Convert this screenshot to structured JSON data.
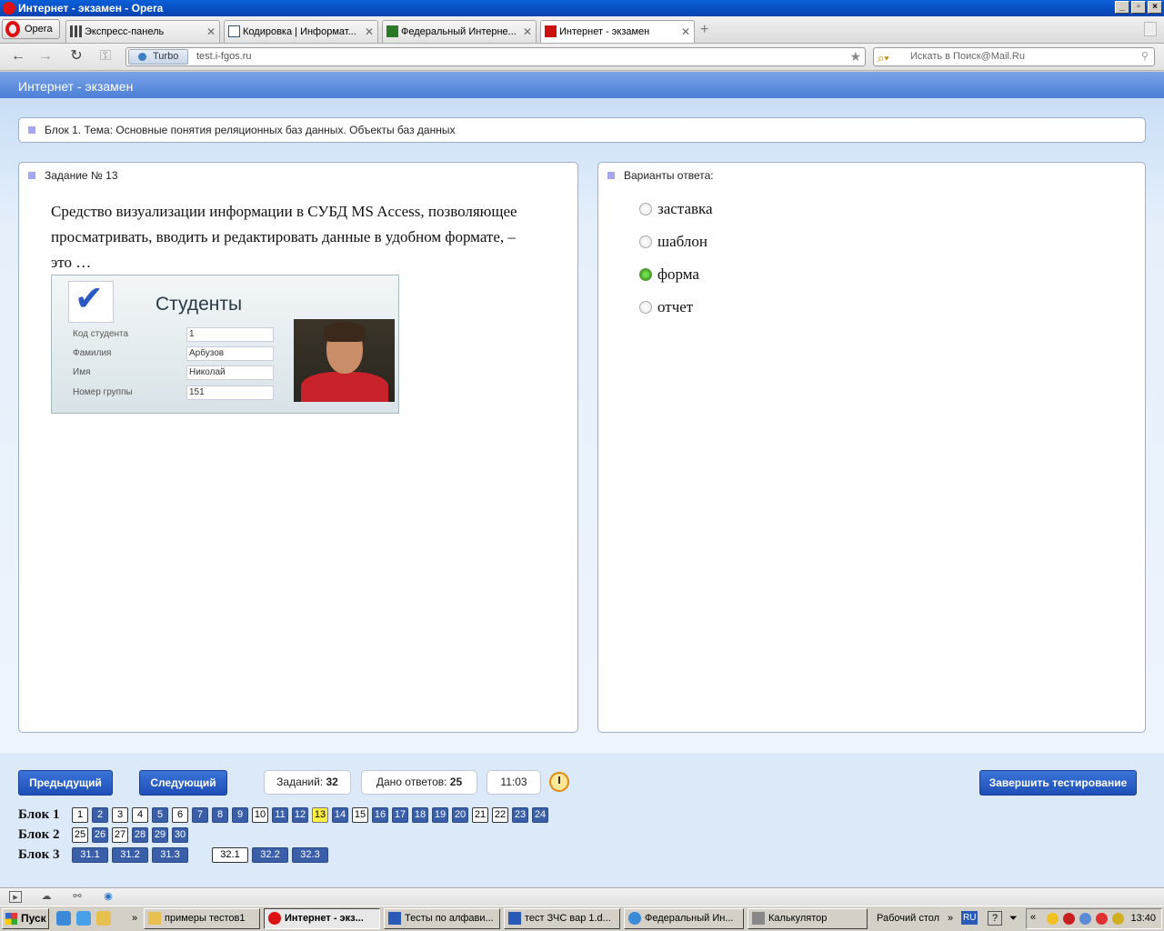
{
  "window": {
    "title": "Интернет - экзамен - Opera"
  },
  "browser": {
    "menu_label": "Opera",
    "tabs": [
      {
        "label": "Экспресс-панель"
      },
      {
        "label": "Кодировка | Информат..."
      },
      {
        "label": "Федеральный Интерне..."
      },
      {
        "label": "Интернет - экзамен"
      }
    ],
    "turbo_label": "Turbo",
    "url": "test.i-fgos.ru",
    "search_placeholder": "Искать в Поиск@Mail.Ru"
  },
  "page": {
    "header": "Интернет - экзамен",
    "block_title": "Блок 1. Тема: Основные понятия реляционных баз данных. Объекты баз данных",
    "task_title": "Задание № 13",
    "question": "Средство визуализации информации в СУБД MS Access, позволяющее просматривать, вводить и редактировать данные в удобном формате, – это …",
    "form_image": {
      "title": "Студенты",
      "fields": [
        {
          "label": "Код студента",
          "value": "1"
        },
        {
          "label": "Фамилия",
          "value": "Арбузов"
        },
        {
          "label": "Имя",
          "value": "Николай"
        },
        {
          "label": "Номер группы",
          "value": "151"
        }
      ]
    },
    "answers_title": "Варианты ответа:",
    "answers": [
      {
        "label": "заставка",
        "selected": false
      },
      {
        "label": "шаблон",
        "selected": false
      },
      {
        "label": "форма",
        "selected": true
      },
      {
        "label": "отчет",
        "selected": false
      }
    ]
  },
  "controls": {
    "prev": "Предыдущий",
    "next": "Следующий",
    "tasks_label": "Заданий:",
    "tasks_count": "32",
    "answered_label": "Дано ответов:",
    "answered_count": "25",
    "timer": "11:03",
    "finish": "Завершить тестирование"
  },
  "blocks": [
    {
      "label": "Блок 1",
      "items": [
        {
          "n": "1",
          "s": "white"
        },
        {
          "n": "2",
          "s": "blue"
        },
        {
          "n": "3",
          "s": "white"
        },
        {
          "n": "4",
          "s": "white"
        },
        {
          "n": "5",
          "s": "blue"
        },
        {
          "n": "6",
          "s": "white"
        },
        {
          "n": "7",
          "s": "blue"
        },
        {
          "n": "8",
          "s": "blue"
        },
        {
          "n": "9",
          "s": "blue"
        },
        {
          "n": "10",
          "s": "white"
        },
        {
          "n": "11",
          "s": "blue"
        },
        {
          "n": "12",
          "s": "blue"
        },
        {
          "n": "13",
          "s": "yellow"
        },
        {
          "n": "14",
          "s": "blue"
        },
        {
          "n": "15",
          "s": "white"
        },
        {
          "n": "16",
          "s": "blue"
        },
        {
          "n": "17",
          "s": "blue"
        },
        {
          "n": "18",
          "s": "blue"
        },
        {
          "n": "19",
          "s": "blue"
        },
        {
          "n": "20",
          "s": "blue"
        },
        {
          "n": "21",
          "s": "white"
        },
        {
          "n": "22",
          "s": "white"
        },
        {
          "n": "23",
          "s": "blue"
        },
        {
          "n": "24",
          "s": "blue"
        }
      ]
    },
    {
      "label": "Блок 2",
      "items": [
        {
          "n": "25",
          "s": "white"
        },
        {
          "n": "26",
          "s": "blue"
        },
        {
          "n": "27",
          "s": "white"
        },
        {
          "n": "28",
          "s": "blue"
        },
        {
          "n": "29",
          "s": "blue"
        },
        {
          "n": "30",
          "s": "blue"
        }
      ]
    },
    {
      "label": "Блок 3",
      "items": [
        {
          "n": "31.1",
          "s": "blue"
        },
        {
          "n": "31.2",
          "s": "blue"
        },
        {
          "n": "31.3",
          "s": "blue"
        },
        {
          "n": "32.1",
          "s": "white"
        },
        {
          "n": "32.2",
          "s": "blue"
        },
        {
          "n": "32.3",
          "s": "blue"
        }
      ]
    }
  ],
  "taskbar": {
    "start": "Пуск",
    "tasks": [
      {
        "label": "примеры тестов1"
      },
      {
        "label": "Интернет - экз..."
      },
      {
        "label": "Тесты по алфави..."
      },
      {
        "label": "тест ЗЧС вар 1.d..."
      },
      {
        "label": "Федеральный Ин..."
      },
      {
        "label": "Калькулятор"
      }
    ],
    "desktop": "Рабочий стол",
    "lang": "RU",
    "time": "13:40"
  }
}
